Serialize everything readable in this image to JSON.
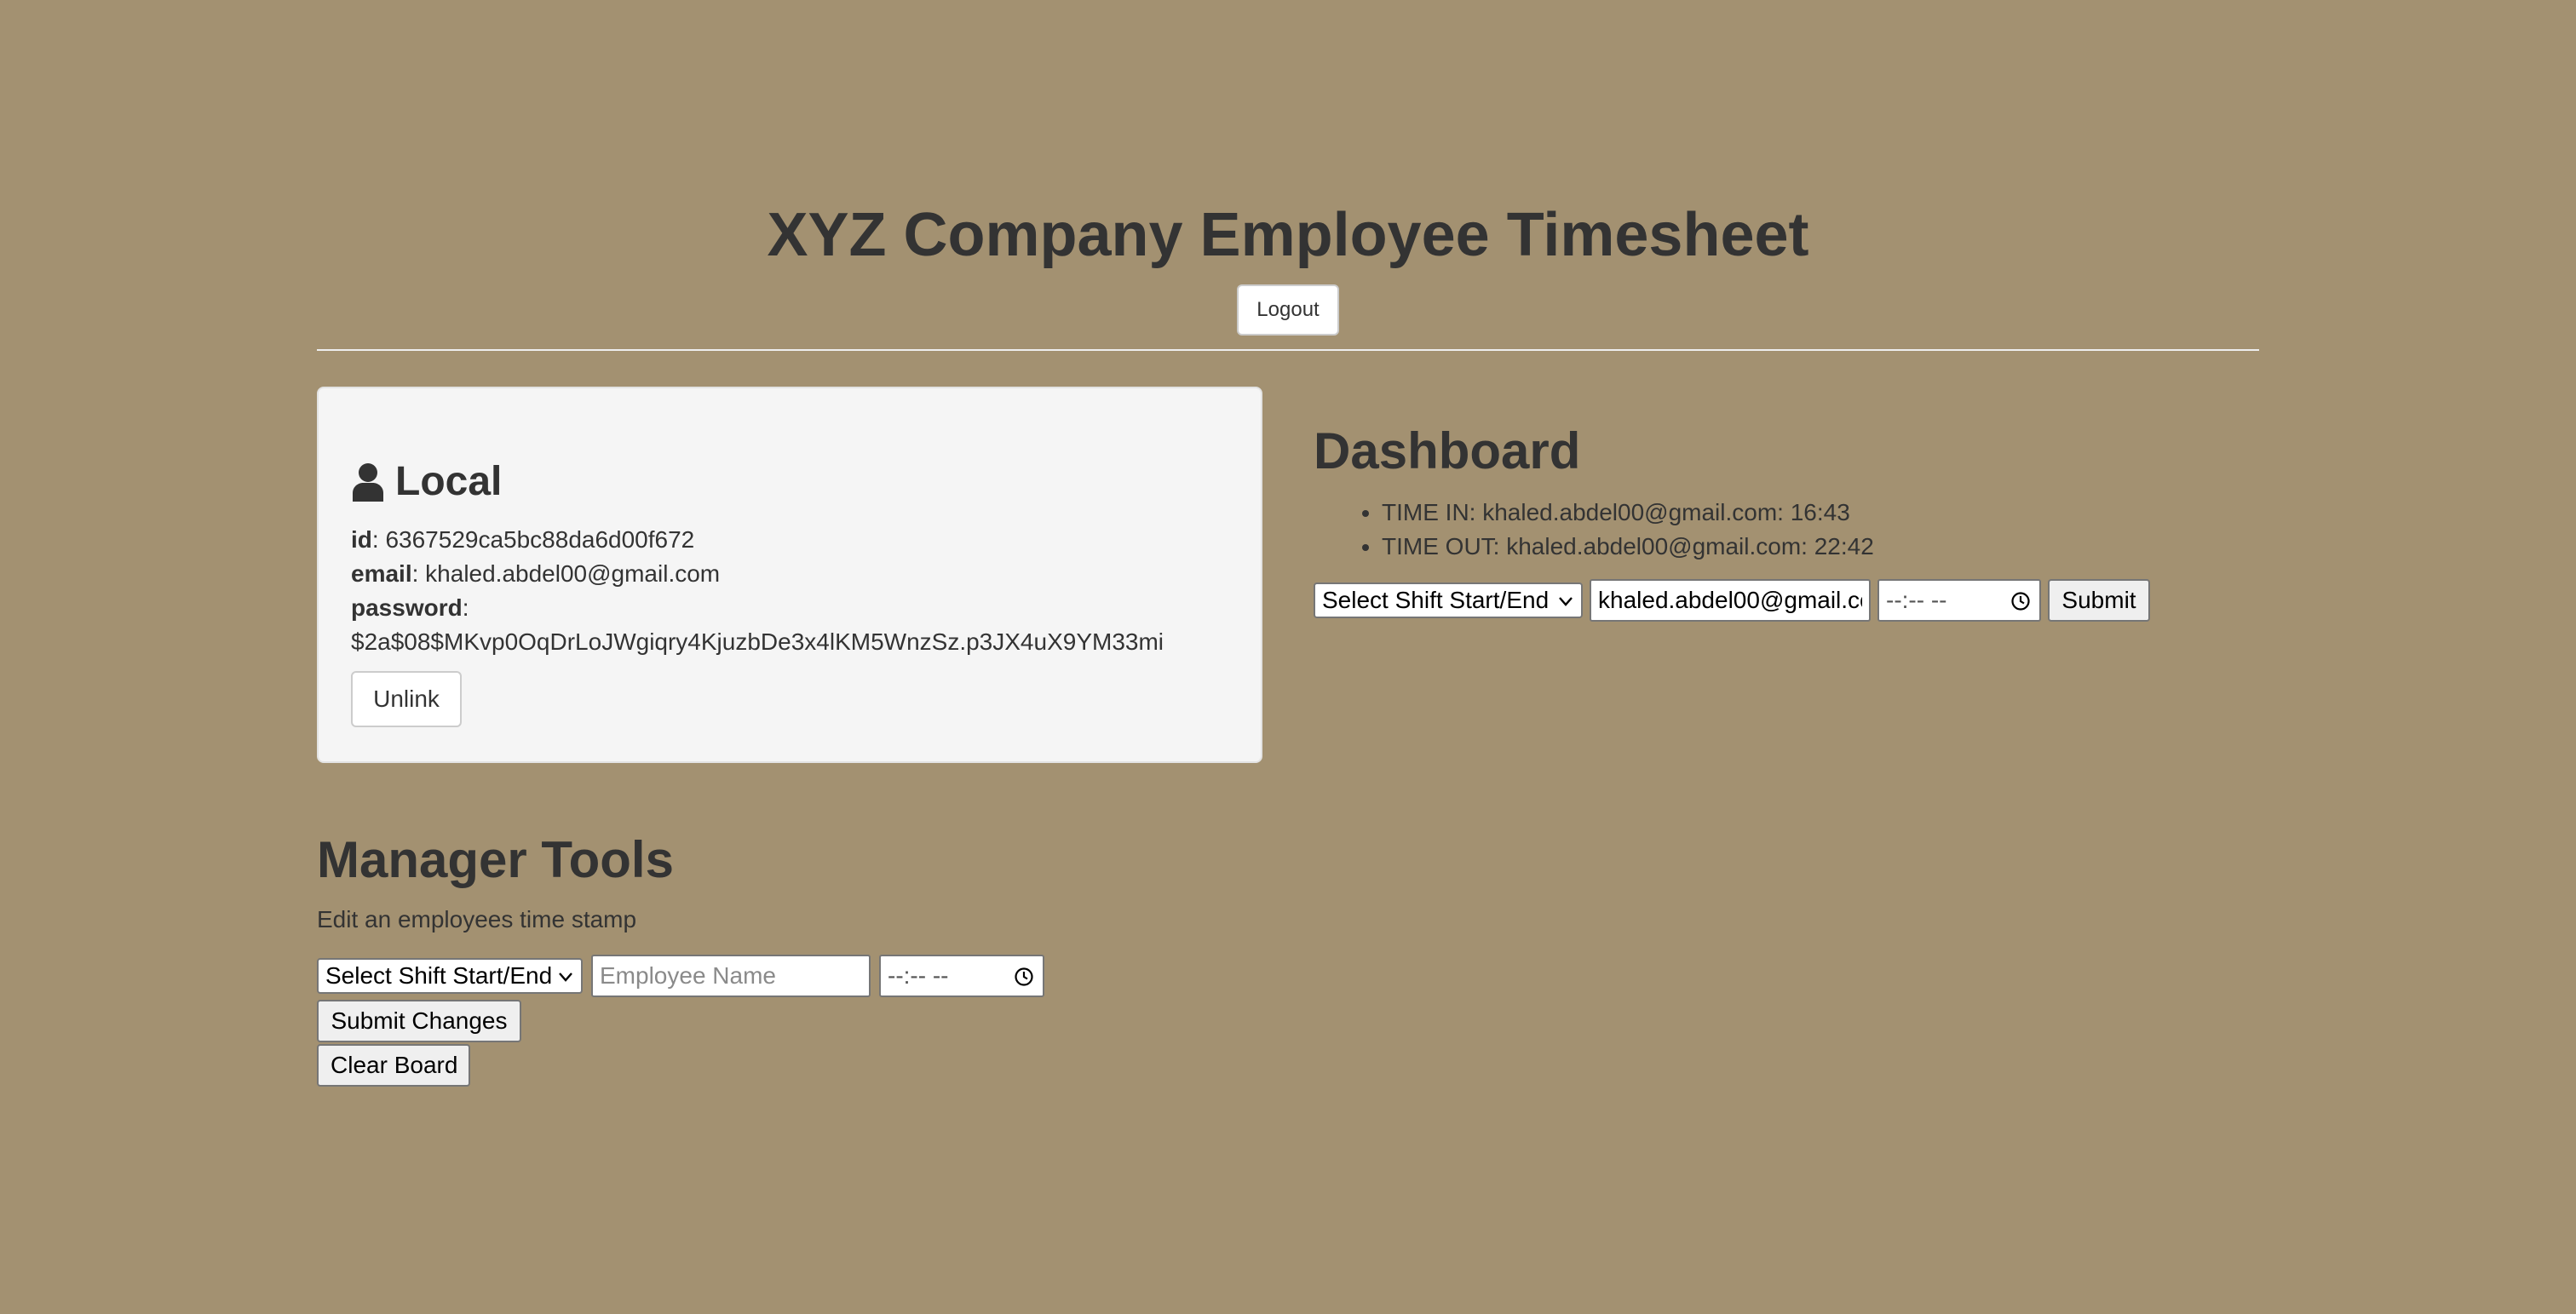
{
  "header": {
    "title": "XYZ Company Employee Timesheet",
    "logout_label": "Logout"
  },
  "local": {
    "heading": "Local",
    "icon": "user-icon",
    "id_label": "id",
    "id_value": "6367529ca5bc88da6d00f672",
    "email_label": "email",
    "email_value": "khaled.abdel00@gmail.com",
    "password_label": "password",
    "password_value": "$2a$08$MKvp0OqDrLoJWgiqry4KjuzbDe3x4lKM5WnzSz.p3JX4uX9YM33mi",
    "unlink_label": "Unlink"
  },
  "dashboard": {
    "title": "Dashboard",
    "entries": [
      "TIME IN: khaled.abdel00@gmail.com: 16:43",
      "TIME OUT: khaled.abdel00@gmail.com: 22:42"
    ],
    "form": {
      "select_value": "Select Shift Start/End",
      "email_value": "khaled.abdel00@gmail.com",
      "time_value": "--:-- --",
      "submit_label": "Submit"
    }
  },
  "manager": {
    "title": "Manager Tools",
    "subtitle": "Edit an employees time stamp",
    "form": {
      "select_value": "Select Shift Start/End",
      "name_placeholder": "Employee Name",
      "time_value": "--:-- --",
      "submit_changes_label": "Submit Changes",
      "clear_board_label": "Clear Board"
    }
  },
  "colors": {
    "background": "#a39171",
    "text": "#333333",
    "card": "#f5f5f5"
  }
}
